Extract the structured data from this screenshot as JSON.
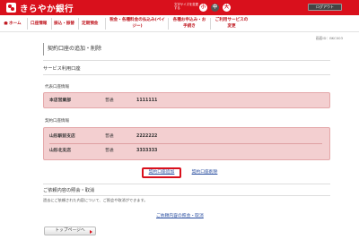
{
  "header": {
    "bank_name": "きらやか銀行",
    "font_size_label": "文字サイズを変更する",
    "font_sizes": [
      "小",
      "中",
      "大"
    ],
    "logout_label": "ログアウト",
    "brand_color": "#d9101c"
  },
  "nav": {
    "items": [
      {
        "label": "ホーム",
        "icon": "home-icon"
      },
      {
        "label": "口座情報"
      },
      {
        "label": "振込・振替"
      },
      {
        "label": "定期預金"
      },
      {
        "label": "税金・各種料金の払込み(ペイジー)"
      },
      {
        "label": "各種お申込み・お手続き"
      },
      {
        "label": "ご利用サービスの変更"
      }
    ]
  },
  "screen_id": "画面ID：BKC003",
  "page_title": "契約口座の追加・削除",
  "service_section_title": "サービス利用口座",
  "representative": {
    "label": "代表口座情報",
    "accounts": [
      {
        "branch": "本店営業部",
        "type": "普通",
        "number": "1111111"
      }
    ]
  },
  "contract": {
    "label": "契約口座情報",
    "accounts": [
      {
        "branch": "山形駅前支店",
        "type": "普通",
        "number": "2222222"
      },
      {
        "branch": "山形北支店",
        "type": "普通",
        "number": "3333333"
      }
    ]
  },
  "buttons": {
    "add": "契約口座追加",
    "delete": "契約口座削除"
  },
  "inquiry": {
    "title": "ご依頼内容の照会・取消",
    "description": "過去にご依頼された内容について、ご照会や取消ができます。",
    "link": "ご依頼内容の照会・取消"
  },
  "top_button": "トップページへ"
}
